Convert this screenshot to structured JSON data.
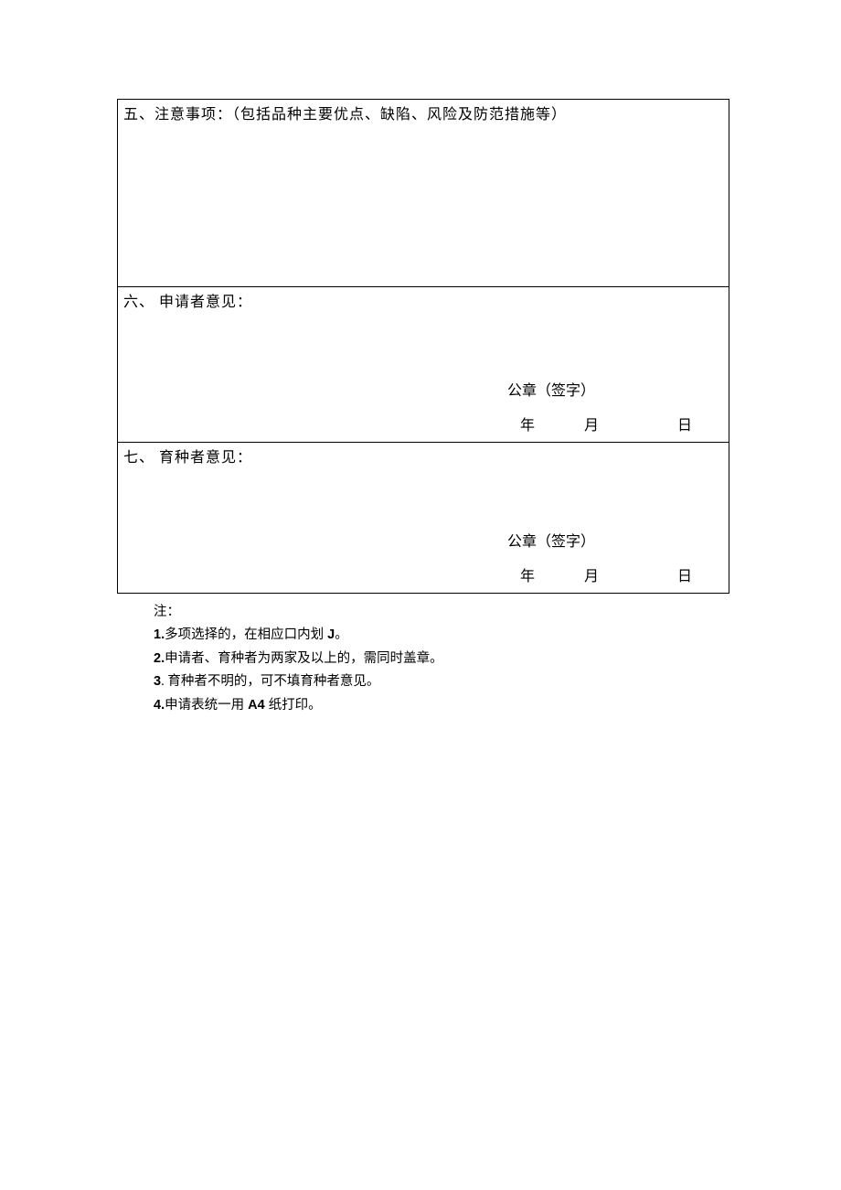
{
  "sections": {
    "five": {
      "heading": "五、注意事项：（包括品种主要优点、缺陷、风险及防范措施等）"
    },
    "six": {
      "heading": "六、 申请者意见：",
      "seal": "公章（签字）",
      "year": "年",
      "month": "月",
      "day": "日"
    },
    "seven": {
      "heading": "七、 育种者意见：",
      "seal": "公章（签字）",
      "year": "年",
      "month": "月",
      "day": "日"
    }
  },
  "notes": {
    "heading": "注：",
    "items": [
      {
        "num": "1.",
        "text": "多项选择的，在相应口内划",
        "bold_suffix": " J",
        "suffix": "。"
      },
      {
        "num": "2.",
        "text": "申请者、育种者为两家及以上的，需同时盖章。"
      },
      {
        "num": "3",
        "dot": ". ",
        "text": "育种者不明的，可不填育种者意见。"
      },
      {
        "num": "4.",
        "text": "申请表统一用",
        "bold_mid": " A4 ",
        "suffix": "纸打印。"
      }
    ]
  }
}
